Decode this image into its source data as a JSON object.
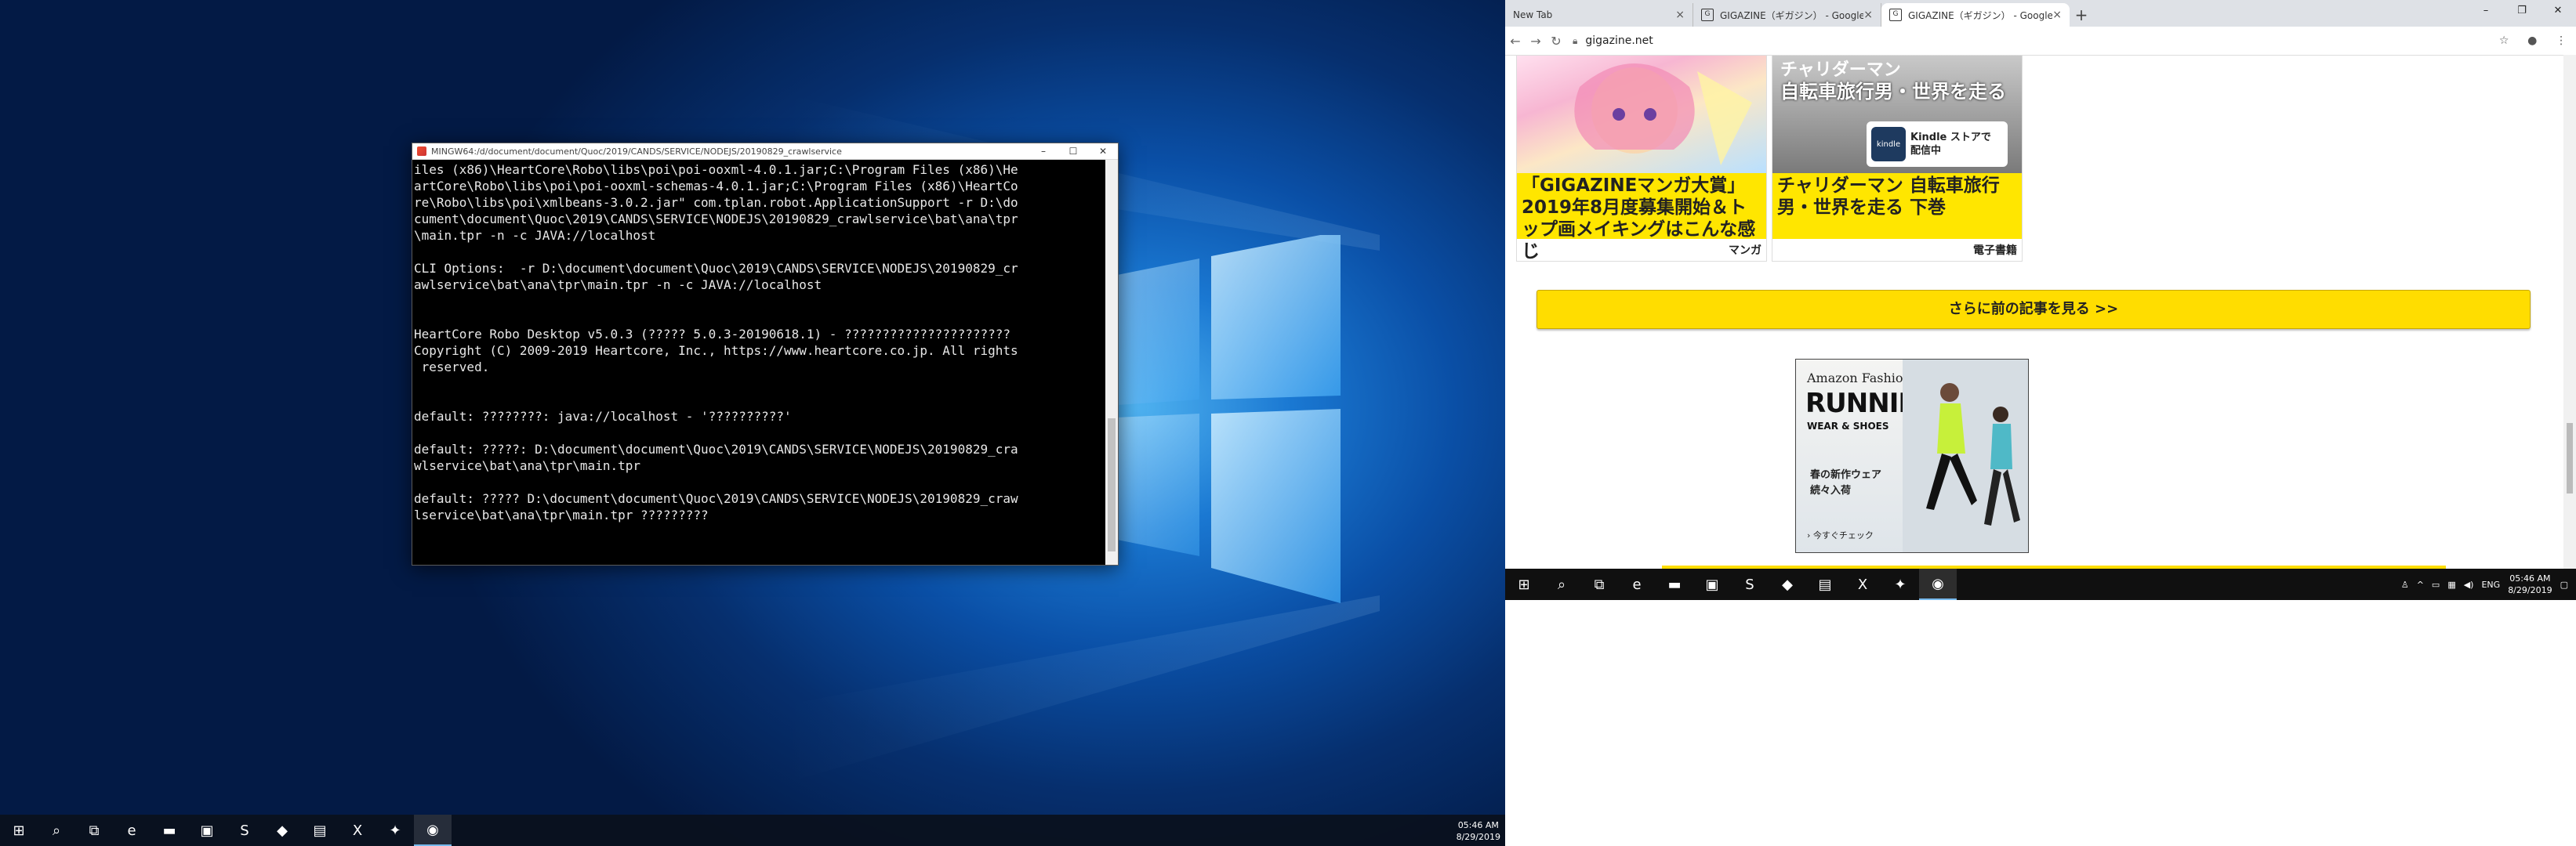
{
  "left_monitor": {
    "terminal": {
      "title": "MINGW64:/d/document/document/Quoc/2019/CANDS/SERVICE/NODEJS/20190829_crawlservice",
      "lines": [
        "iles (x86)\\HeartCore\\Robo\\libs\\poi\\poi-ooxml-4.0.1.jar;C:\\Program Files (x86)\\He",
        "artCore\\Robo\\libs\\poi\\poi-ooxml-schemas-4.0.1.jar;C:\\Program Files (x86)\\HeartCo",
        "re\\Robo\\libs\\poi\\xmlbeans-3.0.2.jar\" com.tplan.robot.ApplicationSupport -r D:\\do",
        "cument\\document\\Quoc\\2019\\CANDS\\SERVICE\\NODEJS\\20190829_crawlservice\\bat\\ana\\tpr",
        "\\main.tpr -n -c JAVA://localhost",
        "",
        "CLI Options:  -r D:\\document\\document\\Quoc\\2019\\CANDS\\SERVICE\\NODEJS\\20190829_cr",
        "awlservice\\bat\\ana\\tpr\\main.tpr -n -c JAVA://localhost",
        "",
        "",
        "HeartCore Robo Desktop v5.0.3 (????? 5.0.3-20190618.1) - ??????????????????????",
        "Copyright (C) 2009-2019 Heartcore, Inc., https://www.heartcore.co.jp. All rights",
        " reserved.",
        "",
        "",
        "default: ????????: java://localhost - '??????????'",
        "",
        "default: ?????: D:\\document\\document\\Quoc\\2019\\CANDS\\SERVICE\\NODEJS\\20190829_cra",
        "wlservice\\bat\\ana\\tpr\\main.tpr",
        "",
        "default: ????? D:\\document\\document\\Quoc\\2019\\CANDS\\SERVICE\\NODEJS\\20190829_craw",
        "lservice\\bat\\ana\\tpr\\main.tpr ?????????"
      ]
    },
    "taskbar": {
      "apps": [
        {
          "name": "start-icon",
          "glyph": "⊞"
        },
        {
          "name": "search-icon",
          "glyph": "⌕"
        },
        {
          "name": "task-view-icon",
          "glyph": "⧉"
        },
        {
          "name": "edge-icon",
          "glyph": "e"
        },
        {
          "name": "file-explorer-icon",
          "glyph": "▬"
        },
        {
          "name": "app-icon",
          "glyph": "▣"
        },
        {
          "name": "skype-icon",
          "glyph": "S"
        },
        {
          "name": "app2-icon",
          "glyph": "◆"
        },
        {
          "name": "notepad-icon",
          "glyph": "▤"
        },
        {
          "name": "excel-icon",
          "glyph": "X"
        },
        {
          "name": "app3-icon",
          "glyph": "✦"
        },
        {
          "name": "chrome-icon",
          "glyph": "◉"
        }
      ],
      "time": "05:46 AM",
      "date": "8/29/2019"
    }
  },
  "right_monitor": {
    "browser": {
      "tabs": [
        {
          "label": "New Tab"
        },
        {
          "label": "GIGAZINE（ギガジン） - Google"
        },
        {
          "label": "GIGAZINE（ギガジン） - Google"
        }
      ],
      "url": "gigazine.net",
      "cards": [
        {
          "title": "「GIGAZINEマンガ大賞」2019年8月度募集開始＆トップ画メイキングはこんな感じ",
          "category": "マンガ"
        },
        {
          "title": "チャリダーマン 自転車旅行男・世界を走る 下巻",
          "category": "電子書籍",
          "banner_top": "チャリダーマン",
          "banner_main": "自転車旅行男・世界を走る",
          "kindle_badge": "Kindle ストアで配信中"
        }
      ],
      "more_button": "さらに前の記事を見る >>",
      "ad": {
        "brand": "Amazon Fashion",
        "headline": "RUNNING",
        "sub": "WEAR & SHOES",
        "body_line1": "春の新作ウェア",
        "body_line2": "続々入荷",
        "cta": "› 今すぐチェック"
      }
    },
    "taskbar": {
      "language": "ENG",
      "time": "05:46 AM",
      "date": "8/29/2019"
    }
  }
}
